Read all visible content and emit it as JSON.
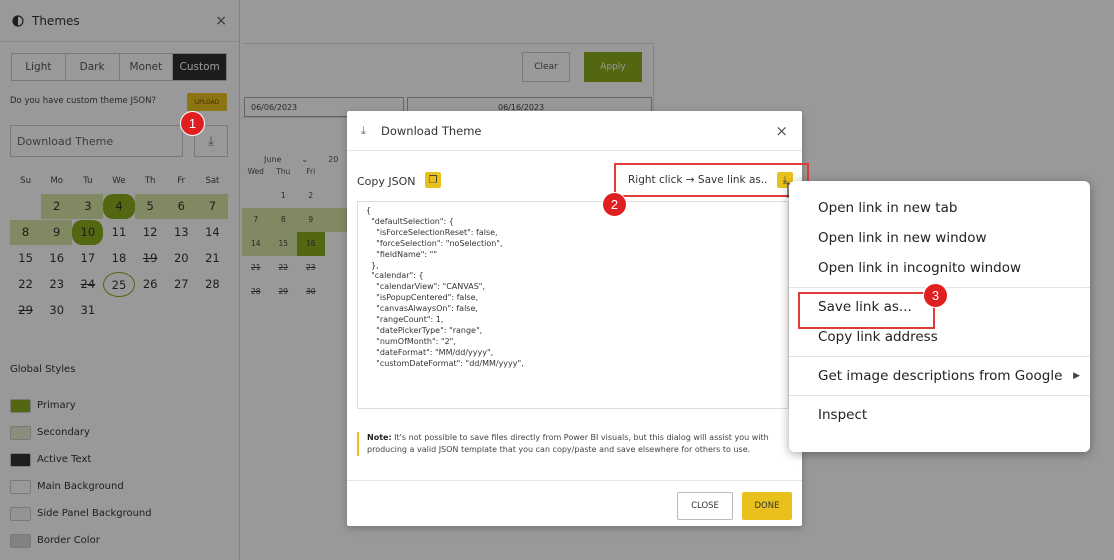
{
  "side_panel": {
    "title": "Themes",
    "theme_tabs": [
      "Light",
      "Dark",
      "Monet",
      "Custom"
    ],
    "custom_question": "Do you have custom theme JSON?",
    "upload_label": "UPLOAD",
    "download_placeholder": "Download Theme",
    "weekdays": [
      "Su",
      "Mo",
      "Tu",
      "We",
      "Th",
      "Fr",
      "Sat"
    ],
    "weeks": [
      [
        "",
        "2",
        "3",
        "4",
        "5",
        "6",
        "7"
      ],
      [
        "8",
        "9",
        "10",
        "11",
        "12",
        "13",
        "14"
      ],
      [
        "15",
        "16",
        "17",
        "18",
        "19",
        "20",
        "21"
      ],
      [
        "22",
        "23",
        "24",
        "25",
        "26",
        "27",
        "28"
      ],
      [
        "29",
        "30",
        "31",
        "",
        "",
        "",
        ""
      ]
    ],
    "global_styles_title": "Global Styles",
    "global_styles": [
      {
        "label": "Primary",
        "color": "#8aaa1b"
      },
      {
        "label": "Secondary",
        "color": "#e6edcf"
      },
      {
        "label": "Active Text",
        "color": "#333333"
      },
      {
        "label": "Main Background",
        "color": "#ffffff"
      },
      {
        "label": "Side Panel Background",
        "color": "#f7f7f7"
      },
      {
        "label": "Border Color",
        "color": "#d9d9d9"
      }
    ]
  },
  "main": {
    "clear_label": "Clear",
    "apply_label": "Apply",
    "start_date": "06/06/2023",
    "end_date": "06/16/2023",
    "month_label": "June",
    "year_label": "20",
    "bg_weekdays": [
      "Wed",
      "Thu",
      "Fri",
      ""
    ],
    "bg_weeks": [
      [
        "",
        "1",
        "2",
        ""
      ],
      [
        "7",
        "8",
        "9",
        ""
      ],
      [
        "14",
        "15",
        "16",
        ""
      ],
      [
        "21",
        "22",
        "23",
        ""
      ],
      [
        "28",
        "29",
        "30",
        ""
      ]
    ]
  },
  "modal": {
    "title": "Download Theme",
    "close_x": "×",
    "copy_json_label": "Copy JSON",
    "save_hint": "Right click → Save link as..",
    "json_text": "{\n  \"defaultSelection\": {\n    \"isForceSelectionReset\": false,\n    \"forceSelection\": \"noSelection\",\n    \"fieldName\": \"\"\n  },\n  \"calendar\": {\n    \"calendarView\": \"CANVAS\",\n    \"isPopupCentered\": false,\n    \"canvasAlwaysOn\": false,\n    \"rangeCount\": 1,\n    \"datePickerType\": \"range\",\n    \"numOfMonth\": \"2\",\n    \"dateFormat\": \"MM/dd/yyyy\",\n    \"customDateFormat\": \"dd/MM/yyyy\",",
    "note_label": "Note:",
    "note_text": " It's not possible to save files directly from Power BI visuals, but this dialog will assist you with producing a valid JSON template that you can copy/paste and save elsewhere for others to use.",
    "close_label": "CLOSE",
    "done_label": "DONE"
  },
  "context_menu": {
    "items": [
      "Open link in new tab",
      "Open link in new window",
      "Open link in incognito window",
      "Save link as...",
      "Copy link address",
      "Get image descriptions from Google",
      "Inspect"
    ]
  },
  "badges": [
    "1",
    "2",
    "3"
  ]
}
